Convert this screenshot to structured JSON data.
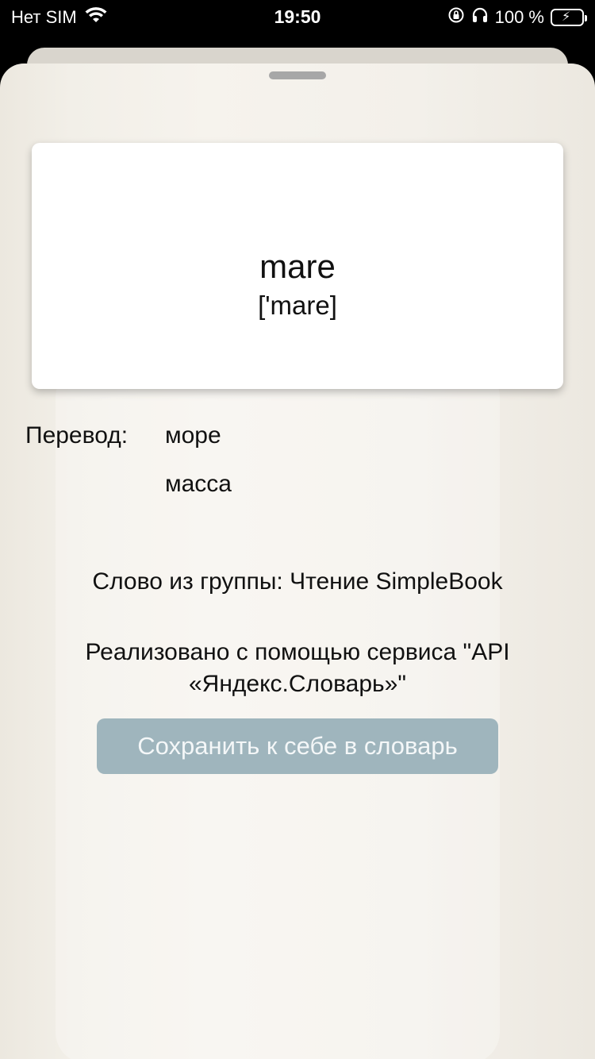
{
  "status_bar": {
    "carrier": "Нет SIM",
    "time": "19:50",
    "battery_percent": "100 %",
    "icons": [
      "wifi-icon",
      "orientation-lock-icon",
      "headphones-icon",
      "battery-charging-icon"
    ],
    "battery_color": "#3fd24a"
  },
  "card": {
    "word": "mare",
    "transcription": "['mare]"
  },
  "translation": {
    "label": "Перевод:",
    "items": [
      "море",
      "масса"
    ]
  },
  "group_line": "Слово из группы: Чтение SimpleBook",
  "attribution": "Реализовано с помощью сервиса \"API «Яндекс.Словарь»\"",
  "save_button": {
    "label": "Сохранить к себе в словарь",
    "color": "#9fb5bd"
  }
}
